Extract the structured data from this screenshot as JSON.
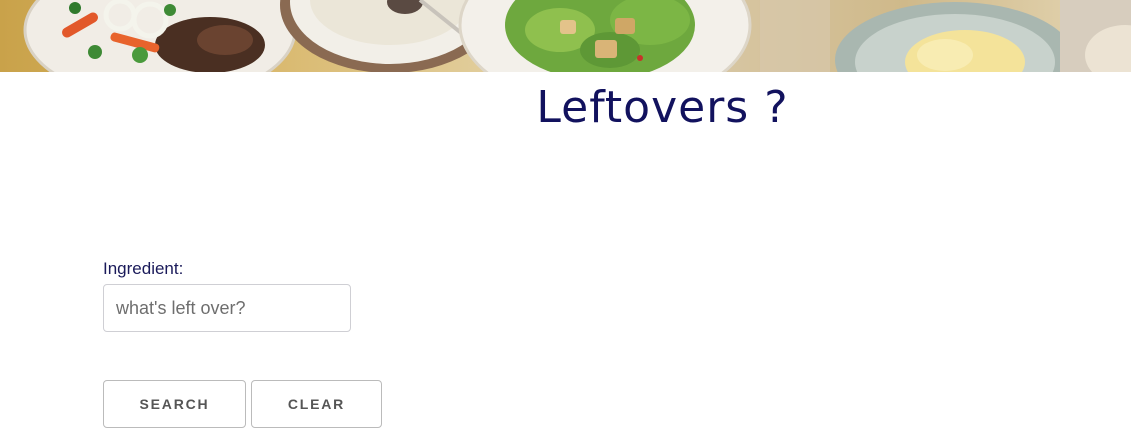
{
  "header": {
    "title": "Leftovers ?"
  },
  "form": {
    "ingredient_label": "Ingredient:",
    "ingredient_placeholder": "what's left over?",
    "ingredient_value": ""
  },
  "buttons": {
    "search_label": "SEARCH",
    "clear_label": "CLEAR"
  },
  "colors": {
    "title": "#12125e",
    "label": "#1a1a5a",
    "button_text": "#555555",
    "button_border": "#bbbbbb"
  }
}
